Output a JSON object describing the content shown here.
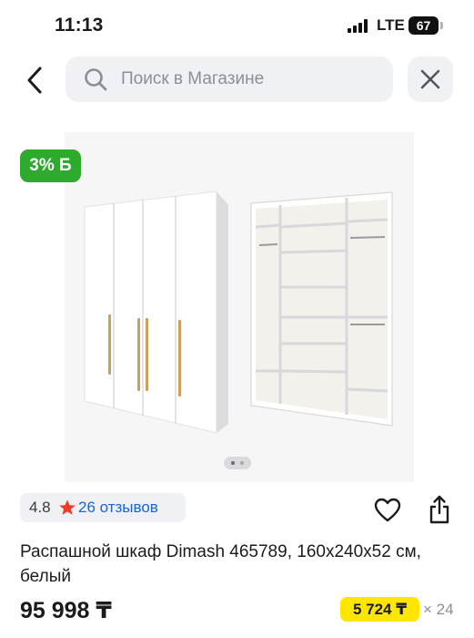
{
  "status_bar": {
    "time": "11:13",
    "network": "LTE",
    "battery": "67"
  },
  "search": {
    "placeholder": "Поиск в Магазине"
  },
  "product": {
    "cashback_badge": "3% Б",
    "cashback_color": "#2eaa2e",
    "image_icon": "wardrobe-image",
    "gallery_pages": 2,
    "rating": "4.8",
    "reviews_label": "26 отзывов",
    "title": "Распашной шкаф Dimash 465789, 160x240x52 см, белый",
    "price": "95 998 ₸",
    "installment_amount": "5 724 ₸",
    "installment_months": "× 24",
    "installment_color": "#ffe600",
    "link_color": "#1a62e0"
  }
}
